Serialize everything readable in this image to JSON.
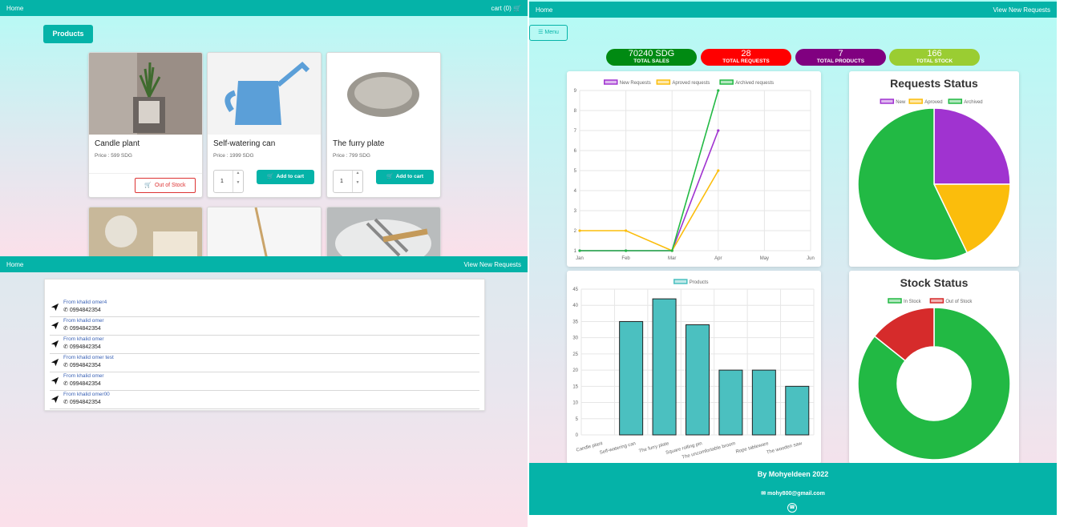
{
  "shop": {
    "nav": {
      "home": "Home",
      "cart": "cart (0)"
    },
    "products_button": "Products",
    "products": [
      {
        "name": "Candle plant",
        "price": "Price : 599 SDG",
        "status": "Out of Stock"
      },
      {
        "name": "Self-watering can",
        "price": "Price : 1999 SDG",
        "qty": "1",
        "action": "Add to cart"
      },
      {
        "name": "The furry plate",
        "price": "Price : 799 SDG",
        "qty": "1",
        "action": "Add to cart"
      }
    ]
  },
  "requests": {
    "nav": {
      "home": "Home",
      "view_new": "View New Requests"
    },
    "messages": [
      {
        "from": "From khalid omer4",
        "phone": "0994842354"
      },
      {
        "from": "From khalid omer",
        "phone": "0994842354"
      },
      {
        "from": "From khalid omer",
        "phone": "0994842354"
      },
      {
        "from": "From khalid omer test",
        "phone": "0994842354"
      },
      {
        "from": "From khalid omer",
        "phone": "0994842354"
      },
      {
        "from": "From khalid omer00",
        "phone": "0994842354"
      }
    ]
  },
  "dashboard": {
    "nav": {
      "home": "Home",
      "view_new": "View New Requests"
    },
    "menu_button": "Menu",
    "stats": [
      {
        "value": "70240 SDG",
        "caption": "TOTAL SALES",
        "color": "#008a12"
      },
      {
        "value": "28",
        "caption": "TOTAL REQUESTS",
        "color": "#ff0000"
      },
      {
        "value": "7",
        "caption": "TOTAL PRODUCTS",
        "color": "#800080"
      },
      {
        "value": "166",
        "caption": "TOTAL STOCK",
        "color": "#9acd32"
      }
    ],
    "footer": {
      "by": "By Mohyeldeen 2022",
      "email": "mohy800@gmail.com"
    }
  },
  "chart_data": [
    {
      "type": "line",
      "categories": [
        "Jan",
        "Feb",
        "Mar",
        "Apr",
        "May",
        "Jun"
      ],
      "ylim": [
        1,
        9
      ],
      "yticks": [
        "1",
        "2",
        "3",
        "4",
        "5",
        "6",
        "7",
        "8",
        "9"
      ],
      "series": [
        {
          "name": "New Requests",
          "color": "#a033d0",
          "values": [
            1,
            1,
            1,
            7,
            null,
            null
          ]
        },
        {
          "name": "Aproved requests",
          "color": "#fbbd0c",
          "values": [
            2,
            2,
            1,
            5,
            null,
            null
          ]
        },
        {
          "name": "Archived requests",
          "color": "#22b944",
          "values": [
            1,
            1,
            1,
            9,
            null,
            null
          ]
        }
      ],
      "grid": true,
      "legend": "top"
    },
    {
      "type": "pie",
      "title": "Requests Status",
      "labels": [
        "New",
        "Aproved",
        "Archived"
      ],
      "values": [
        7,
        5,
        16
      ],
      "colors": [
        "#a033d0",
        "#fbbd0c",
        "#22b944"
      ],
      "legend": "top"
    },
    {
      "type": "bar",
      "categories": [
        "Candle plant",
        "Self-watering can",
        "The furry plate",
        "Square rolling pin",
        "The uncomfortable broom",
        "Rope tableware",
        "The wooden saw"
      ],
      "series": [
        {
          "name": "Products",
          "values": [
            0,
            35,
            42,
            34,
            20,
            20,
            15
          ],
          "color": "#4bc0c0"
        }
      ],
      "ylim": [
        0,
        45
      ],
      "yticks": [
        "0",
        "5",
        "10",
        "15",
        "20",
        "25",
        "30",
        "35",
        "40",
        "45"
      ],
      "grid": true,
      "legend": "top"
    },
    {
      "type": "pie",
      "title": "Stock Status",
      "labels": [
        "In Stock",
        "Out of Stock"
      ],
      "values": [
        6,
        1
      ],
      "colors": [
        "#22b944",
        "#d62b2b"
      ],
      "legend": "top"
    }
  ]
}
